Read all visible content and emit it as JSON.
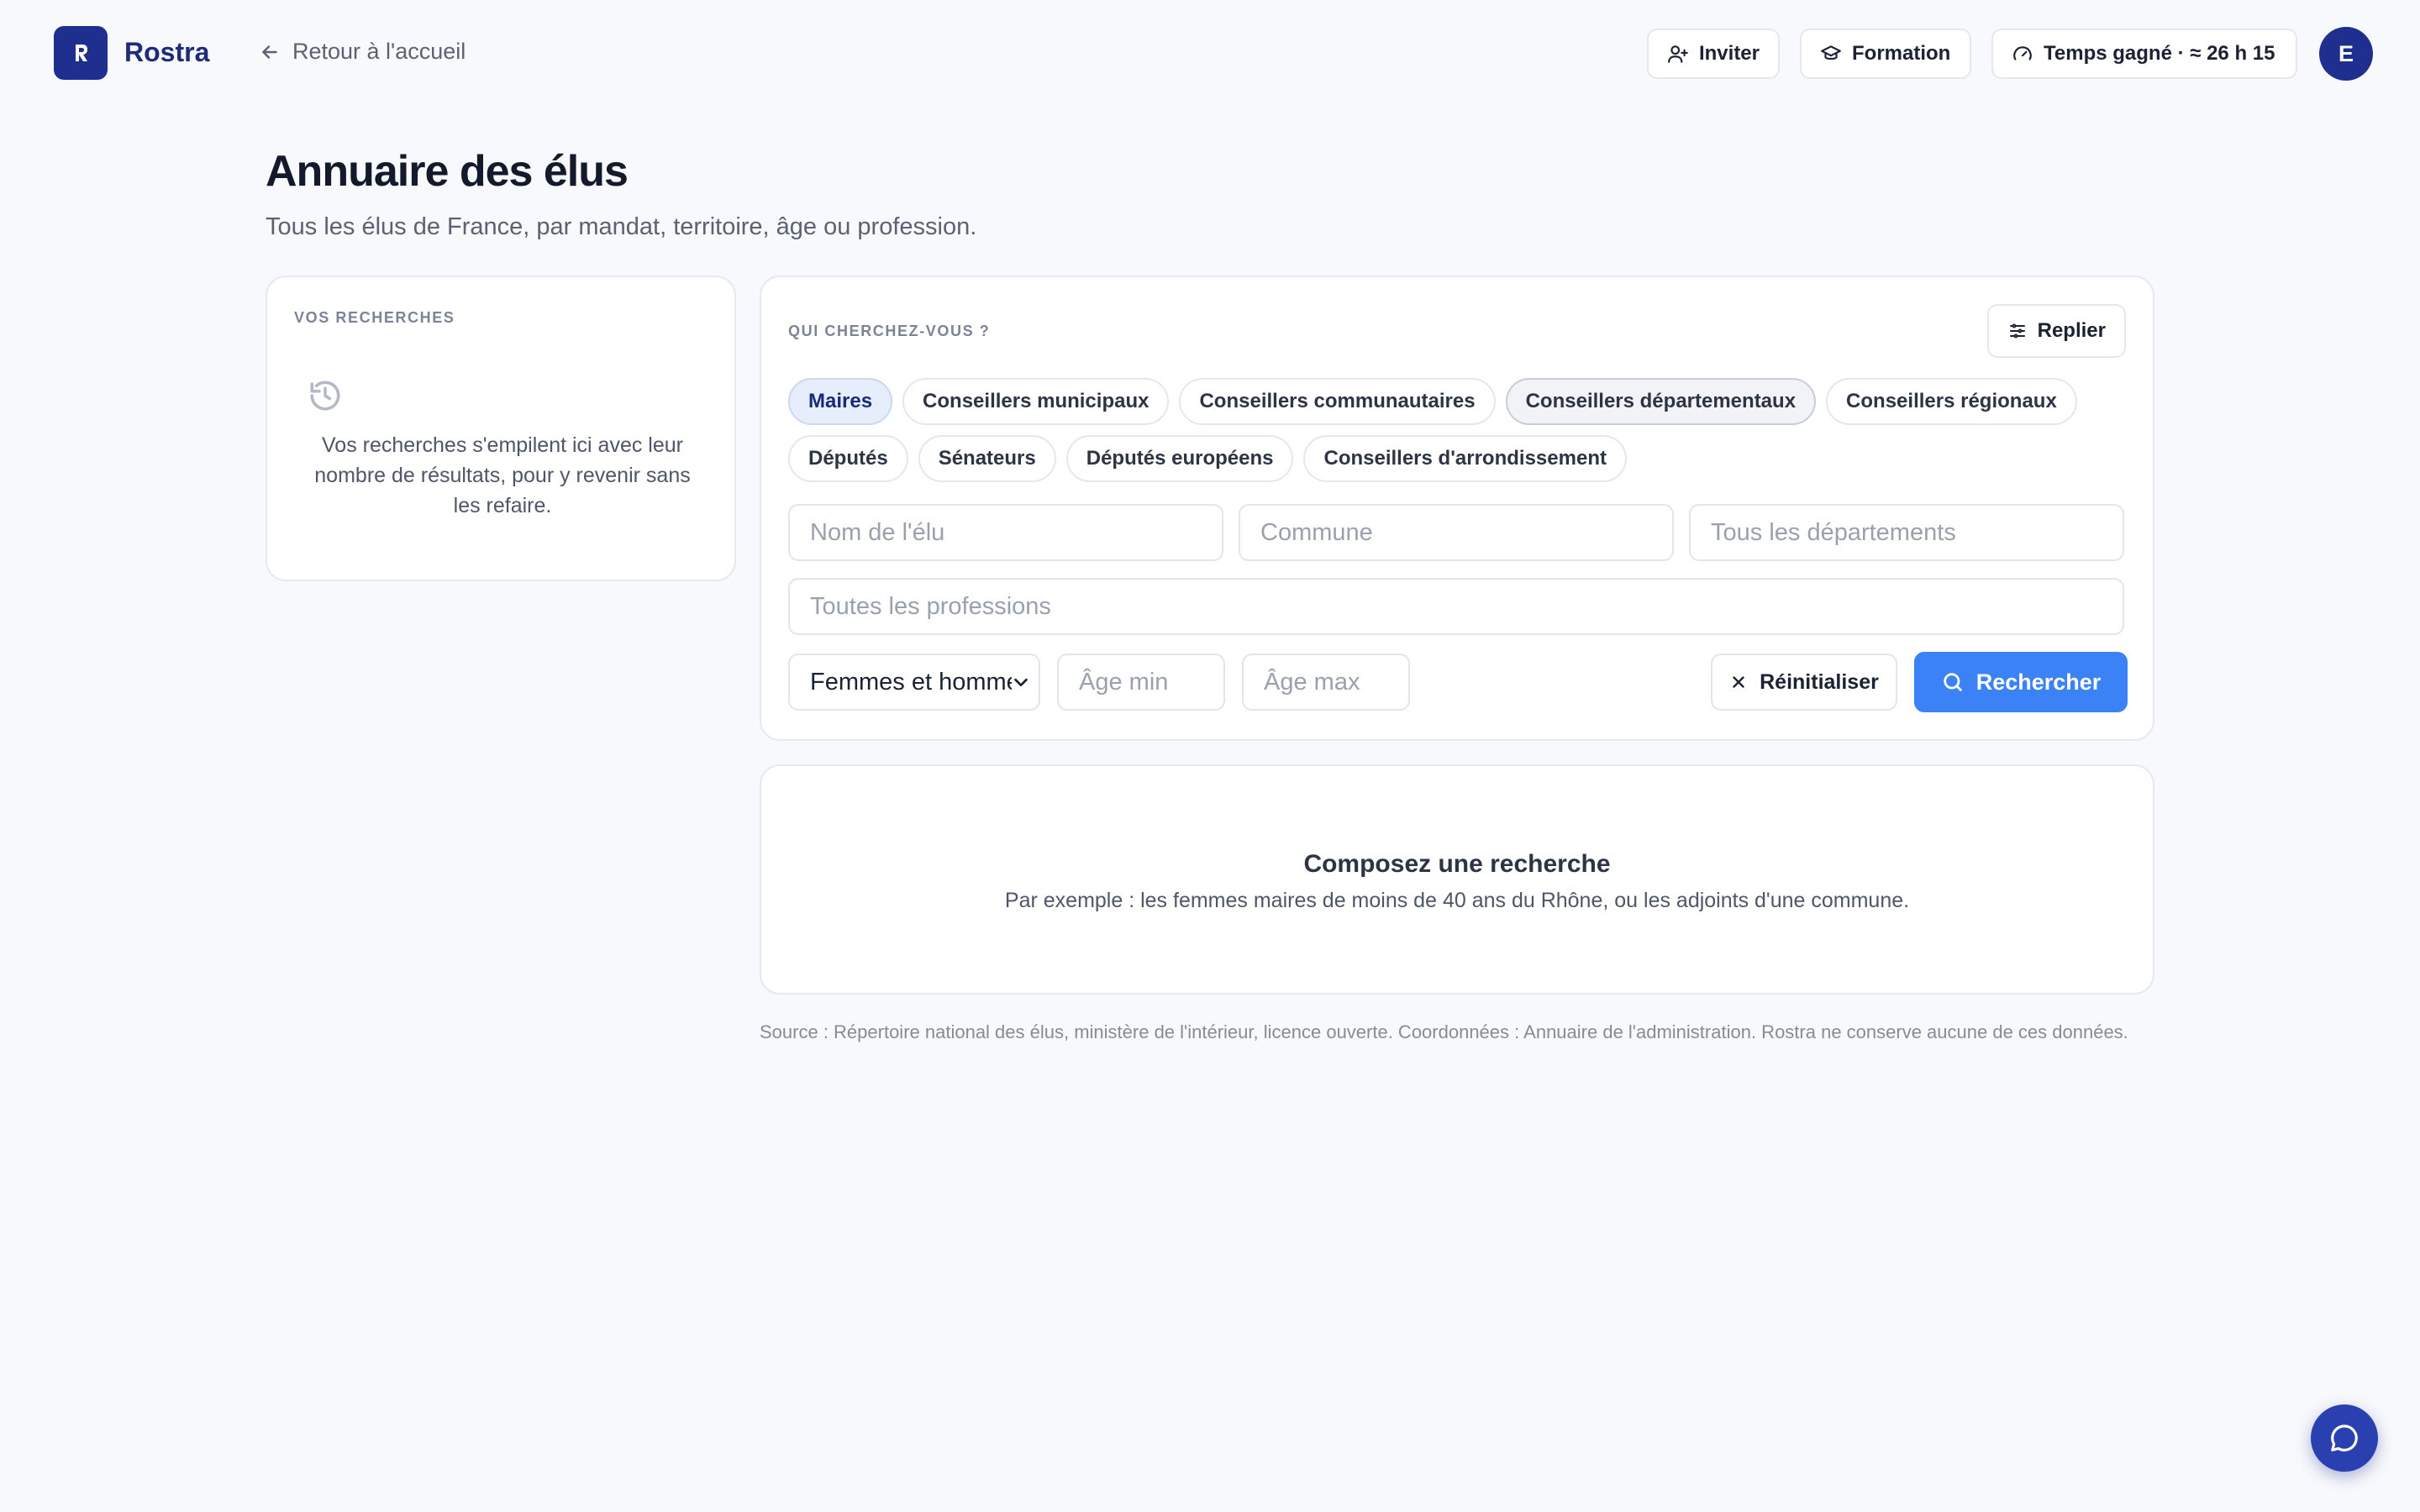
{
  "app": {
    "brand": "Rostra",
    "back_link": "Retour à l'accueil",
    "accent_color": "#1e2f8f",
    "primary_color": "#3b82f6"
  },
  "header_actions": {
    "invite": "Inviter",
    "formation": "Formation",
    "time_saved": "Temps gagné · ≈ 26 h 15",
    "avatar_initial": "E"
  },
  "page": {
    "title": "Annuaire des élus",
    "subtitle": "Tous les élus de France, par mandat, territoire, âge ou profession."
  },
  "history": {
    "label": "VOS RECHERCHES",
    "empty_text": "Vos recherches s'empilent ici avec leur nombre de résultats, pour y revenir sans les refaire."
  },
  "search": {
    "label": "QUI CHERCHEZ-VOUS ?",
    "fold_button": "Replier",
    "mandates_row1": [
      {
        "label": "Maires",
        "state": "active"
      },
      {
        "label": "Conseillers municipaux",
        "state": "default"
      },
      {
        "label": "Conseillers communautaires",
        "state": "default"
      },
      {
        "label": "Conseillers départementaux",
        "state": "hover"
      },
      {
        "label": "Conseillers régionaux",
        "state": "default"
      }
    ],
    "mandates_row2": [
      {
        "label": "Députés",
        "state": "default"
      },
      {
        "label": "Sénateurs",
        "state": "default"
      },
      {
        "label": "Députés européens",
        "state": "default"
      },
      {
        "label": "Conseillers d'arrondissement",
        "state": "default"
      }
    ],
    "name_placeholder": "Nom de l'élu",
    "commune_placeholder": "Commune",
    "department_placeholder": "Tous les départements",
    "profession_placeholder": "Toutes les professions",
    "sex_selected": "Femmes et hommes",
    "age_min_placeholder": "Âge min",
    "age_max_placeholder": "Âge max",
    "reset_button": "Réinitialiser",
    "search_button": "Rechercher"
  },
  "empty_state": {
    "title": "Composez une recherche",
    "text": "Par exemple : les femmes maires de moins de 40 ans du Rhône, ou les adjoints d'une commune."
  },
  "footer": {
    "source": "Source : Répertoire national des élus, ministère de l'intérieur, licence ouverte. Coordonnées : Annuaire de l'administration. Rostra ne conserve aucune de ces données."
  }
}
